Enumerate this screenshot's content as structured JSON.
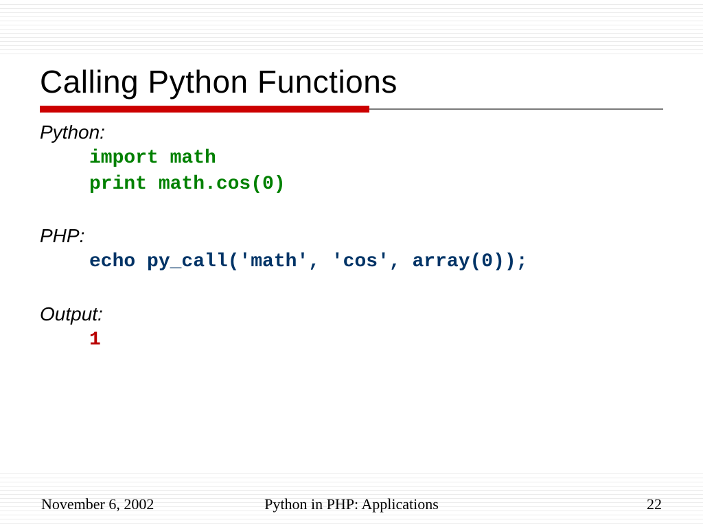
{
  "title": "Calling Python Functions",
  "sections": {
    "python": {
      "label": "Python:",
      "code1": "import math",
      "code2": "print math.cos(0)"
    },
    "php": {
      "label": "PHP:",
      "code": "echo py_call('math', 'cos', array(0));"
    },
    "output": {
      "label": "Output:",
      "value": "1"
    }
  },
  "footer": {
    "date": "November 6, 2002",
    "subject": "Python in PHP: Applications",
    "page": "22"
  },
  "style": {
    "accent_red": "#cc0000",
    "code_green": "#008000",
    "code_navy": "#003366",
    "output_red": "#b90000"
  }
}
